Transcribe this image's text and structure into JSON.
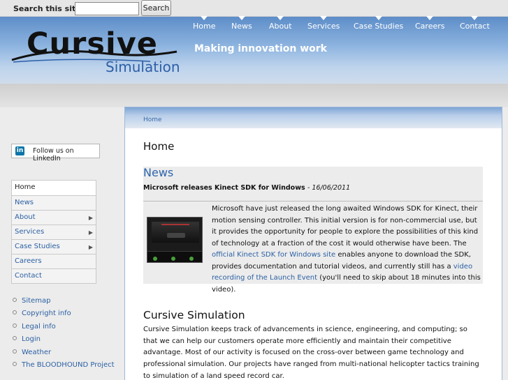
{
  "search": {
    "label": "Search this site:",
    "value": "",
    "button": "Search"
  },
  "header": {
    "logo_main": "Cursive",
    "logo_sub": "Simulation",
    "tagline": "Making innovation work",
    "nav": [
      "Home",
      "News",
      "About",
      "Services",
      "Case Studies",
      "Careers",
      "Contact"
    ]
  },
  "breadcrumb": "Home",
  "page_title": "Home",
  "news": {
    "heading": "News",
    "title": "Microsoft releases Kinect SDK for Windows",
    "date": "- 16/06/2011",
    "text_1": "Microsoft have just released the long awaited Windows SDK for Kinect, their motion sensing controller. This initial version is for non-commercial use, but it provides the opportunity for people to explore the possibilities of this kind of technology at a fraction of the cost it would otherwise have been. The ",
    "link_1": "official Kinect SDK for Windows site",
    "text_2": " enables anyone to download the SDK, provides documentation and tutorial videos, and currently still has a ",
    "link_2": "video recording of the Launch Event",
    "text_3": " (you'll need to skip about 18 minutes into this video)."
  },
  "section": {
    "title": "Cursive Simulation",
    "body": "Cursive Simulation keeps track of advancements in science, engineering, and computing; so that we can help our customers operate more efficiently and maintain their competitive advantage. Most of our activity is focused on the cross-over between game technology and professional simulation. Our projects have ranged from multi-national helicopter tactics training to simulation of a land speed record car."
  },
  "sidebar": {
    "linkedin": "Follow us on LinkedIn",
    "linkedin_badge": "in",
    "menu": [
      {
        "label": "Home",
        "arrow": ""
      },
      {
        "label": "News",
        "arrow": ""
      },
      {
        "label": "About",
        "arrow": "▶"
      },
      {
        "label": "Services",
        "arrow": "▶"
      },
      {
        "label": "Case Studies",
        "arrow": "▶"
      },
      {
        "label": "Careers",
        "arrow": ""
      },
      {
        "label": "Contact",
        "arrow": ""
      }
    ],
    "links": [
      "Sitemap",
      "Copyright info",
      "Legal info",
      "Login",
      "Weather",
      "The BLOODHOUND Project"
    ]
  },
  "icons": {
    "nav_tick": "triangle-down-icon",
    "submenu": "chevron-right-icon",
    "bullet": "circle-bullet-icon",
    "linkedin": "linkedin-icon"
  },
  "colors": {
    "accent": "#2d65ad",
    "header_top": "#5d8dc8",
    "link": "#2a5fa3"
  }
}
